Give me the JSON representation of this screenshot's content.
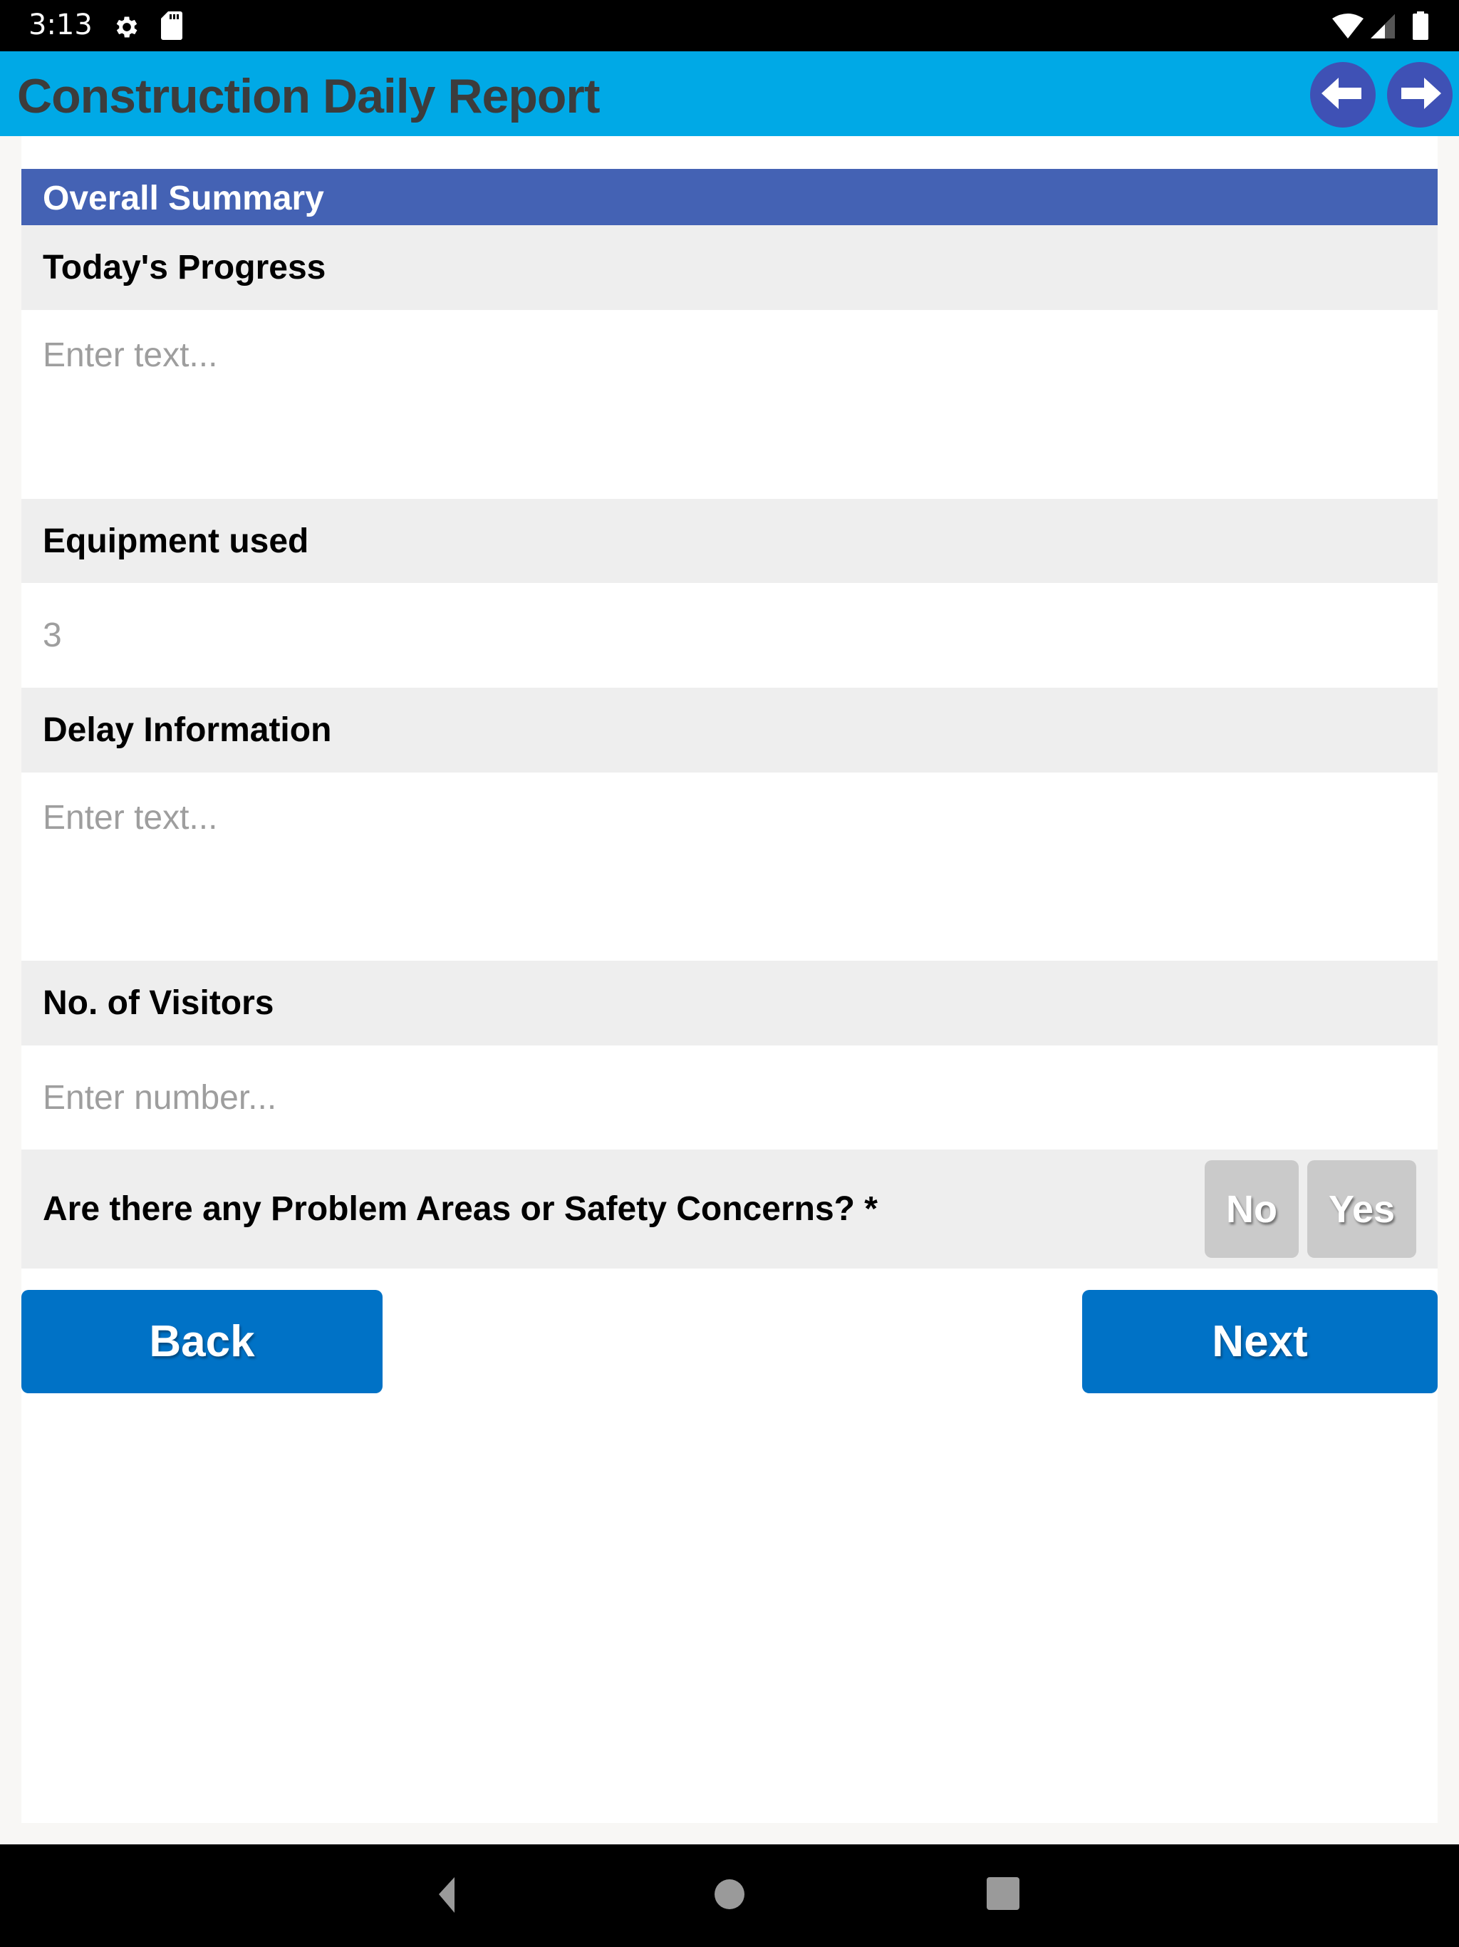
{
  "status_bar": {
    "time": "3:13",
    "icons": [
      "gear-icon",
      "sd-card-icon",
      "wifi-icon",
      "signal-icon",
      "battery-icon"
    ]
  },
  "app_bar": {
    "title": "Construction Daily Report",
    "prev_icon": "arrow-left-icon",
    "next_icon": "arrow-right-icon"
  },
  "colors": {
    "app_bar": "#00a9e6",
    "title_text": "#3c3c3c",
    "nav_circle": "#3f51b5",
    "section_header": "#4462b4",
    "label_row": "#eeeeee",
    "toggle_inactive": "#cacaca",
    "primary_button": "#0072c6"
  },
  "form": {
    "section_title": "Overall Summary",
    "fields": [
      {
        "label": "Today's Progress",
        "type": "textarea",
        "value": "",
        "placeholder": "Enter text..."
      },
      {
        "label": "Equipment used",
        "type": "number",
        "value": "3",
        "placeholder": ""
      },
      {
        "label": "Delay Information",
        "type": "textarea",
        "value": "",
        "placeholder": "Enter text..."
      },
      {
        "label": "No. of Visitors",
        "type": "number",
        "value": "",
        "placeholder": "Enter number..."
      }
    ],
    "question": {
      "label": "Are there any Problem Areas or Safety Concerns? *",
      "options": [
        "No",
        "Yes"
      ],
      "selected": null
    },
    "back_label": "Back",
    "next_label": "Next"
  },
  "system_nav": {
    "back_icon": "triangle-back-icon",
    "home_icon": "circle-home-icon",
    "recents_icon": "square-recents-icon"
  }
}
